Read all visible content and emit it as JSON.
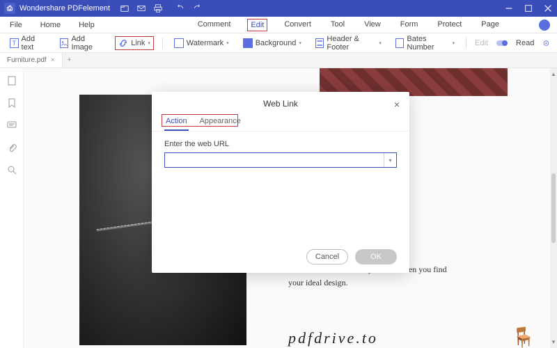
{
  "titlebar": {
    "app_name": "Wondershare PDFelement"
  },
  "menubar": {
    "left": [
      "File",
      "Home",
      "Help"
    ],
    "center": [
      "Comment",
      "Edit",
      "Convert",
      "Tool",
      "View",
      "Form",
      "Protect",
      "Page"
    ],
    "highlighted": "Edit"
  },
  "toolbar": {
    "add_text": "Add text",
    "add_image": "Add Image",
    "link": "Link",
    "watermark": "Watermark",
    "background": "Background",
    "header_footer": "Header & Footer",
    "bates_number": "Bates Number",
    "edit": "Edit",
    "read": "Read"
  },
  "tabs": {
    "open": "Furniture.pdf"
  },
  "document": {
    "body_text": "n is to e an now that only occurs when you find your ideal design.",
    "brand": "pdfdrive.to"
  },
  "modal": {
    "title": "Web Link",
    "tabs": {
      "action": "Action",
      "appearance": "Appearance"
    },
    "label": "Enter the web URL",
    "input_value": "",
    "cancel": "Cancel",
    "ok": "OK"
  }
}
